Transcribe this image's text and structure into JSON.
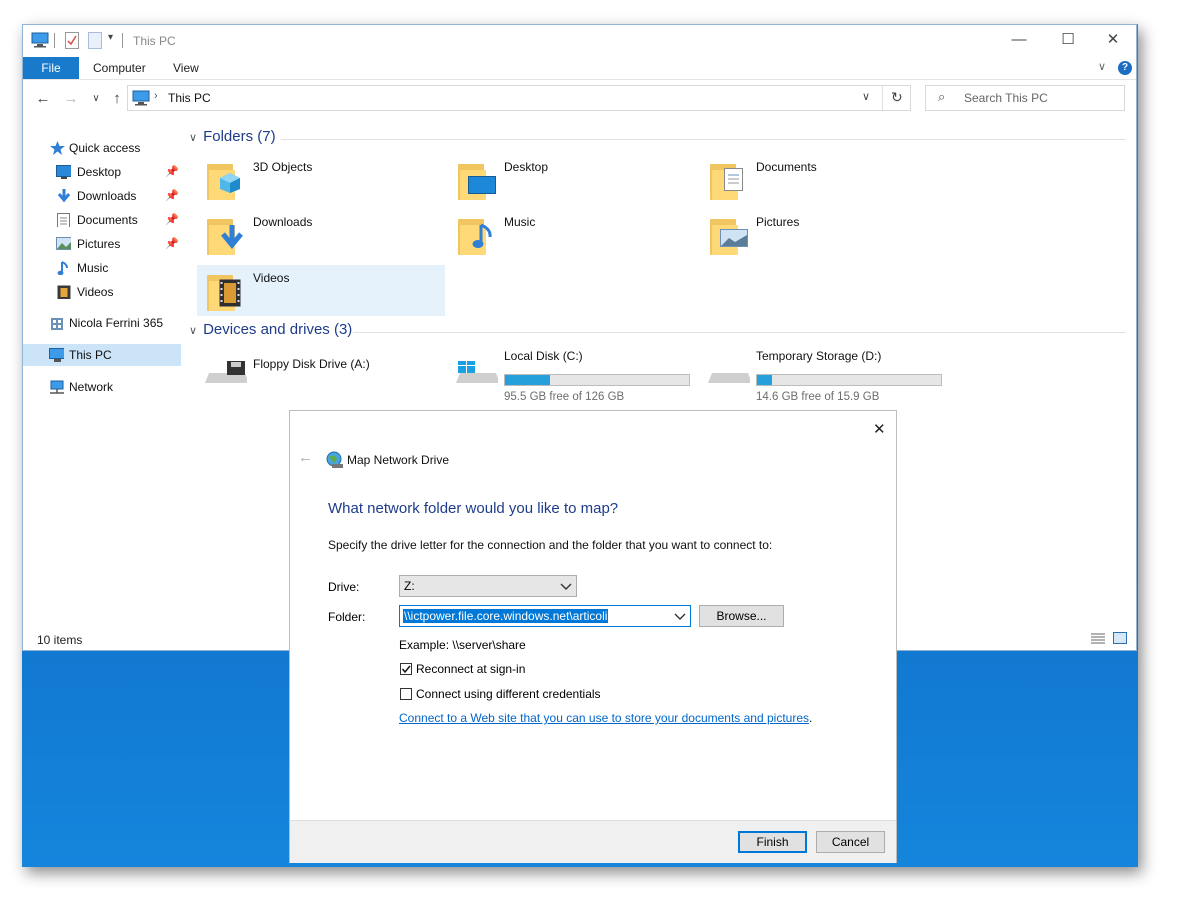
{
  "window": {
    "title": "This PC",
    "minimize_glyph": "—",
    "maximize_glyph": "☐",
    "close_glyph": "✕"
  },
  "ribbon": {
    "tabs": [
      "File",
      "Computer",
      "View"
    ]
  },
  "address": {
    "path": "This PC",
    "search_placeholder": "Search This PC"
  },
  "sidebar": {
    "items": [
      {
        "label": "Quick access",
        "icon": "star-icon"
      },
      {
        "label": "Desktop",
        "icon": "desktop-icon",
        "pinned": true
      },
      {
        "label": "Downloads",
        "icon": "download-arrow-icon",
        "pinned": true
      },
      {
        "label": "Documents",
        "icon": "document-icon",
        "pinned": true
      },
      {
        "label": "Pictures",
        "icon": "picture-icon",
        "pinned": true
      },
      {
        "label": "Music",
        "icon": "music-note-icon"
      },
      {
        "label": "Videos",
        "icon": "film-icon"
      },
      {
        "label": "Nicola Ferrini 365",
        "icon": "onedrive-building-icon"
      },
      {
        "label": "This PC",
        "icon": "computer-icon",
        "selected": true
      },
      {
        "label": "Network",
        "icon": "network-icon"
      }
    ]
  },
  "content": {
    "folders_header": "Folders (7)",
    "folders": [
      {
        "label": "3D Objects",
        "icon": "3d-cube-icon"
      },
      {
        "label": "Desktop",
        "icon": "desktop-icon"
      },
      {
        "label": "Documents",
        "icon": "document-icon"
      },
      {
        "label": "Downloads",
        "icon": "download-arrow-icon"
      },
      {
        "label": "Music",
        "icon": "music-note-icon"
      },
      {
        "label": "Pictures",
        "icon": "picture-icon"
      },
      {
        "label": "Videos",
        "icon": "film-icon",
        "selected": true
      }
    ],
    "drives_header": "Devices and drives (3)",
    "drives": [
      {
        "label": "Floppy Disk Drive (A:)",
        "icon": "floppy-drive-icon"
      },
      {
        "label": "Local Disk (C:)",
        "icon": "windows-drive-icon",
        "free": "95.5 GB free of 126 GB",
        "used_fraction": 0.242
      },
      {
        "label": "Temporary Storage (D:)",
        "icon": "hard-drive-icon",
        "free": "14.6 GB free of 15.9 GB",
        "used_fraction": 0.082
      }
    ]
  },
  "status": {
    "item_count": "10 items"
  },
  "dialog": {
    "title": "Map Network Drive",
    "heading": "What network folder would you like to map?",
    "instruction": "Specify the drive letter for the connection and the folder that you want to connect to:",
    "drive_label": "Drive:",
    "drive_value": "Z:",
    "folder_label": "Folder:",
    "folder_value": "\\\\ictpower.file.core.windows.net\\articoli",
    "browse_label": "Browse...",
    "example": "Example: \\\\server\\share",
    "reconnect_label": "Reconnect at sign-in",
    "reconnect_checked": true,
    "credentials_label": "Connect using different credentials",
    "credentials_checked": false,
    "link_text": "Connect to a Web site that you can use to store your documents and pictures",
    "link_suffix": ".",
    "finish_label": "Finish",
    "cancel_label": "Cancel",
    "close_glyph": "✕"
  }
}
